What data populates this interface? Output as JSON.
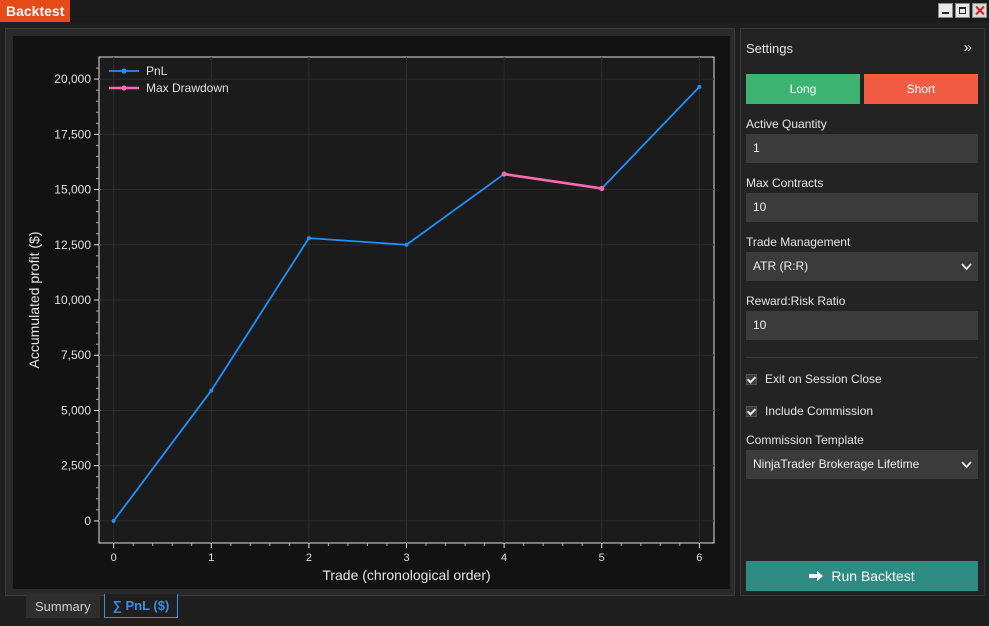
{
  "window": {
    "title": "Backtest"
  },
  "tabs": [
    {
      "label": "Summary",
      "active": false
    },
    {
      "label": "∑ PnL ($)",
      "active": true
    }
  ],
  "settings": {
    "title": "Settings",
    "collapse_icon": "»",
    "long_label": "Long",
    "short_label": "Short",
    "active_quantity": {
      "label": "Active Quantity",
      "value": "1"
    },
    "max_contracts": {
      "label": "Max Contracts",
      "value": "10"
    },
    "trade_management": {
      "label": "Trade Management",
      "value": "ATR (R:R)"
    },
    "reward_risk": {
      "label": "Reward:Risk Ratio",
      "value": "10"
    },
    "exit_session": {
      "label": "Exit on Session Close",
      "checked": true
    },
    "include_commission": {
      "label": "Include Commission",
      "checked": true
    },
    "commission_template": {
      "label": "Commission Template",
      "value": "NinjaTrader Brokerage Lifetime"
    },
    "run_label": "Run Backtest",
    "colors": {
      "long": "#3cb371",
      "short": "#f25c45",
      "run": "#2e8b84"
    }
  },
  "chart_data": {
    "type": "line",
    "xlabel": "Trade (chronological order)",
    "ylabel": "Accumulated profit ($)",
    "x": [
      0,
      1,
      2,
      3,
      4,
      5,
      6
    ],
    "xlim": [
      -0.15,
      6.15
    ],
    "ylim": [
      -1000,
      21000
    ],
    "yticks": [
      0,
      2500,
      5000,
      7500,
      10000,
      12500,
      15000,
      17500,
      20000
    ],
    "ytick_labels": [
      "0",
      "2,500",
      "5,000",
      "7,500",
      "10,000",
      "12,500",
      "15,000",
      "17,500",
      "20,000"
    ],
    "xtick_labels": [
      "0",
      "1",
      "2",
      "3",
      "4",
      "5",
      "6"
    ],
    "grid": true,
    "legend": "top-left",
    "series": [
      {
        "name": "PnL",
        "color": "#1e90ff",
        "x": [
          0,
          1,
          2,
          3,
          4,
          5,
          6
        ],
        "values": [
          0,
          5900,
          12800,
          12500,
          15700,
          15050,
          19650
        ]
      },
      {
        "name": "Max Drawdown",
        "color": "#ff69b4",
        "x": [
          4,
          5
        ],
        "values": [
          15700,
          15050
        ]
      }
    ]
  }
}
